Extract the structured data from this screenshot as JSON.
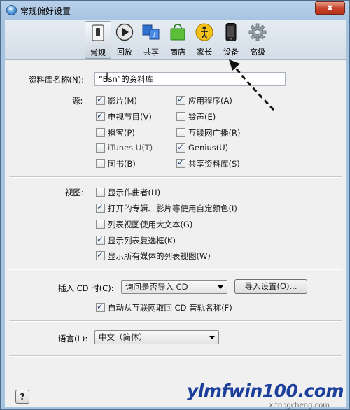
{
  "window": {
    "title": "常规偏好设置",
    "close_label": "x"
  },
  "toolbar": {
    "items": [
      {
        "label": "常规",
        "icon": "general-switch-icon",
        "active": true
      },
      {
        "label": "回放",
        "icon": "play-icon"
      },
      {
        "label": "共享",
        "icon": "sharing-icon"
      },
      {
        "label": "商店",
        "icon": "store-bag-icon"
      },
      {
        "label": "家长",
        "icon": "parental-icon"
      },
      {
        "label": "设备",
        "icon": "iphone-device-icon"
      },
      {
        "label": "高级",
        "icon": "gear-icon"
      }
    ]
  },
  "library": {
    "label": "资料库名称(N):",
    "value": "“Bsn”的资料库"
  },
  "sources": {
    "label": "源:",
    "items": [
      {
        "label": "影片(M)",
        "checked": true
      },
      {
        "label": "应用程序(A)",
        "checked": true
      },
      {
        "label": "电视节目(V)",
        "checked": true
      },
      {
        "label": "铃声(E)",
        "checked": false
      },
      {
        "label": "播客(P)",
        "checked": false
      },
      {
        "label": "互联网广播(R)",
        "checked": false
      },
      {
        "label": "iTunes U(T)",
        "checked": false,
        "disabled": true
      },
      {
        "label": "Genius(U)",
        "checked": true
      },
      {
        "label": "图书(B)",
        "checked": false
      },
      {
        "label": "共享资料库(S)",
        "checked": true
      }
    ]
  },
  "views": {
    "label": "视图:",
    "items": [
      {
        "label": "显示作曲者(H)",
        "checked": false
      },
      {
        "label": "打开的专辑、影片等使用自定颜色(I)",
        "checked": true
      },
      {
        "label": "列表视图使用大文本(G)",
        "checked": false
      },
      {
        "label": "显示列表复选框(K)",
        "checked": true
      },
      {
        "label": "显示所有媒体的列表视图(W)",
        "checked": true
      }
    ]
  },
  "cd": {
    "label": "插入 CD 时(C):",
    "select_value": "询问是否导入 CD",
    "import_button": "导入设置(O)...",
    "auto_fetch": {
      "label": "自动从互联网取回 CD 音轨名称(F)",
      "checked": true
    }
  },
  "language": {
    "label": "语言(L):",
    "select_value": "中文（简体）"
  },
  "help_label": "?",
  "watermark": {
    "main": "ylmfwin100.com",
    "sub": "xitongcheng.com"
  },
  "colors": {
    "accent": "#1d3e73",
    "titlebar": "#b9d1ea",
    "close": "#c7452c"
  }
}
